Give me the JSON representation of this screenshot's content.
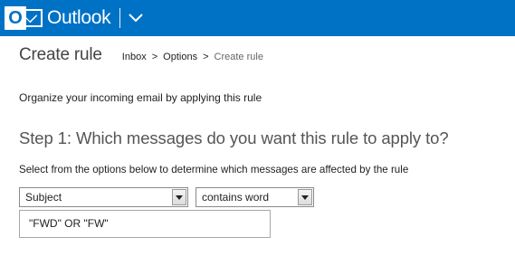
{
  "header": {
    "app_title": "Outlook",
    "logo_letter": "O",
    "brand_color": "#0072c6"
  },
  "page": {
    "title": "Create rule",
    "breadcrumb": {
      "items": [
        "Inbox",
        "Options",
        "Create rule"
      ],
      "separator": ">"
    },
    "intro": "Organize your incoming email by applying this rule"
  },
  "step1": {
    "heading": "Step 1: Which messages do you want this rule to apply to?",
    "instructions": "Select from the options below to determine which messages are affected by the rule",
    "field_select": {
      "selected": "Subject"
    },
    "condition_select": {
      "selected": "contains word"
    },
    "value": "\"FWD\" OR \"FW\""
  },
  "icons": {
    "app_switch": "chevron-down-icon",
    "dropdown": "dropdown-arrow-icon",
    "logo": "outlook-logo-icon"
  }
}
